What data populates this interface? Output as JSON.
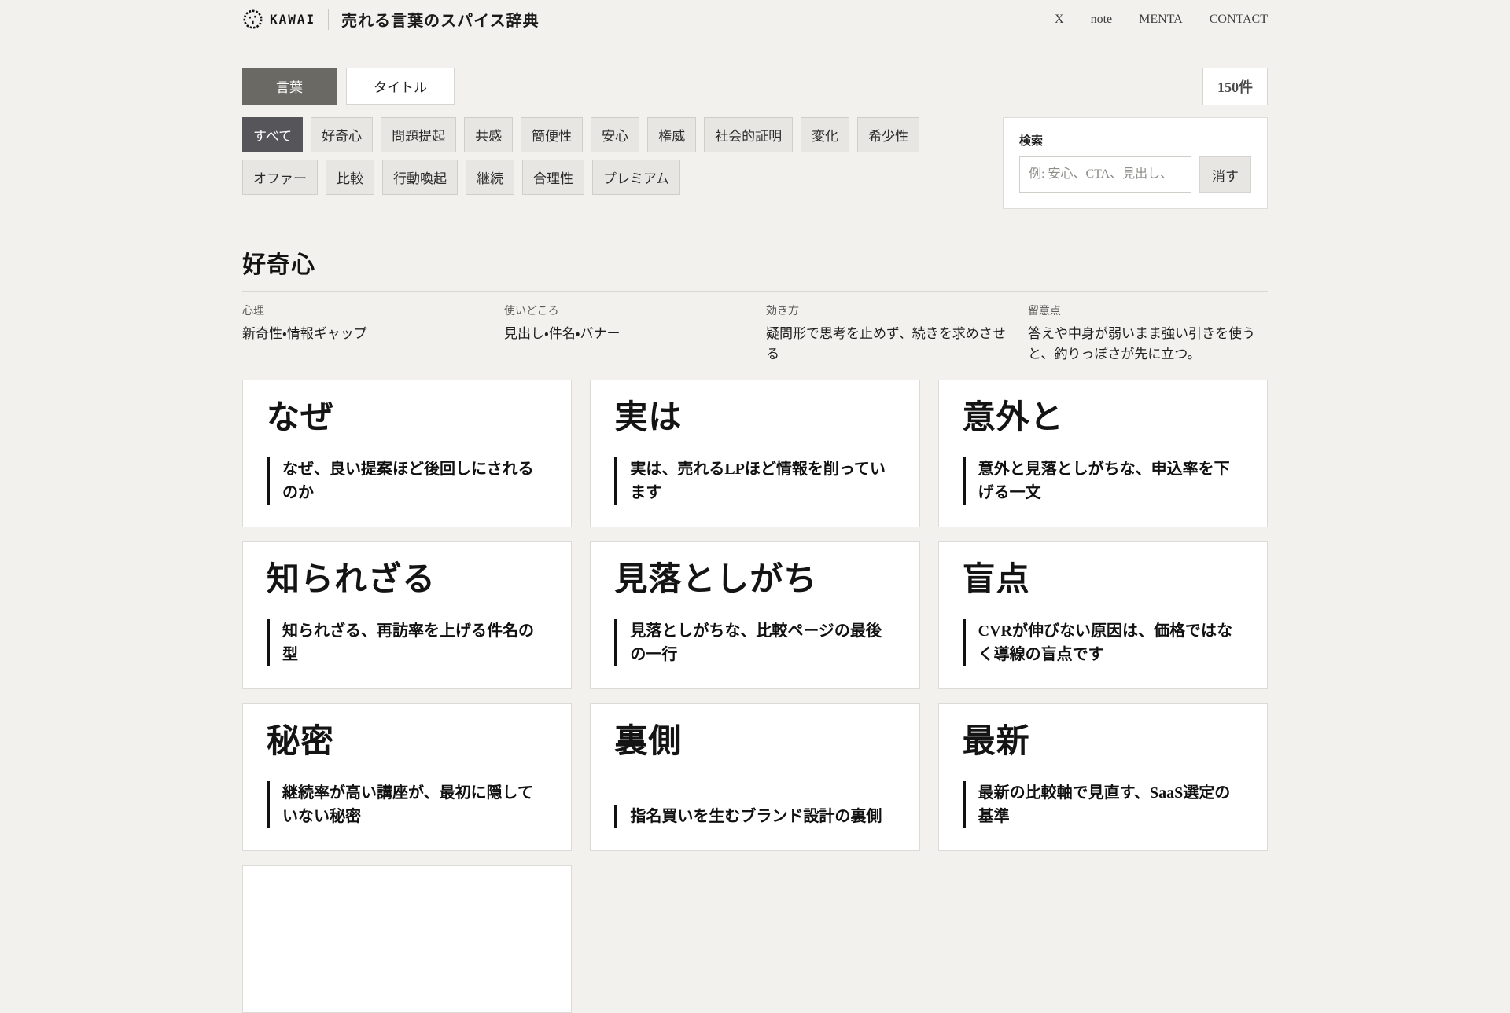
{
  "colors": {
    "page_background": "#f2f1ed",
    "active_tab": "#6a6963",
    "active_filter": "#56565a",
    "card_background": "#ffffff",
    "card_border": "#dcdbd7",
    "quote_bar": "#111111"
  },
  "header": {
    "brand": "KAWAI",
    "logo_icon": "pixel-face-icon",
    "site_title": "売れる言葉のスパイス辞典",
    "nav": [
      {
        "label": "X"
      },
      {
        "label": "note"
      },
      {
        "label": "MENTA"
      },
      {
        "label": "CONTACT"
      }
    ]
  },
  "toolbar": {
    "tabs": [
      {
        "label": "言葉",
        "active": true
      },
      {
        "label": "タイトル",
        "active": false
      }
    ],
    "count_badge": "150件",
    "filters": [
      {
        "label": "すべて",
        "active": true
      },
      {
        "label": "好奇心",
        "active": false
      },
      {
        "label": "問題提起",
        "active": false
      },
      {
        "label": "共感",
        "active": false
      },
      {
        "label": "簡便性",
        "active": false
      },
      {
        "label": "安心",
        "active": false
      },
      {
        "label": "権威",
        "active": false
      },
      {
        "label": "社会的証明",
        "active": false
      },
      {
        "label": "変化",
        "active": false
      },
      {
        "label": "希少性",
        "active": false
      },
      {
        "label": "オファー",
        "active": false
      },
      {
        "label": "比較",
        "active": false
      },
      {
        "label": "行動喚起",
        "active": false
      },
      {
        "label": "継続",
        "active": false
      },
      {
        "label": "合理性",
        "active": false
      },
      {
        "label": "プレミアム",
        "active": false
      }
    ],
    "search": {
      "label": "検索",
      "placeholder": "例: 安心、CTA、見出し、",
      "value": "",
      "clear_label": "消す"
    }
  },
  "section": {
    "title": "好奇心",
    "meta": [
      {
        "label": "心理",
        "value": "新奇性・情報ギャップ"
      },
      {
        "label": "使いどころ",
        "value": "見出し・件名・バナー"
      },
      {
        "label": "効き方",
        "value": "疑問形で思考を止めず、続きを求めさせる"
      },
      {
        "label": "留意点",
        "value": "答えや中身が弱いまま強い引きを使うと、釣りっぽさが先に立つ。"
      }
    ],
    "cards": [
      {
        "title": "なぜ",
        "quote": "なぜ、良い提案ほど後回しにされるのか"
      },
      {
        "title": "実は",
        "quote": "実は、売れるLPほど情報を削っています"
      },
      {
        "title": "意外と",
        "quote": "意外と見落としがちな、申込率を下げる一文"
      },
      {
        "title": "知られざる",
        "quote": "知られざる、再訪率を上げる件名の型"
      },
      {
        "title": "見落としがち",
        "quote": "見落としがちな、比較ページの最後の一行"
      },
      {
        "title": "盲点",
        "quote": "CVRが伸びない原因は、価格ではなく導線の盲点です"
      },
      {
        "title": "秘密",
        "quote": "継続率が高い講座が、最初に隠していない秘密"
      },
      {
        "title": "裏側",
        "quote": "指名買いを生むブランド設計の裏側"
      },
      {
        "title": "最新",
        "quote": "最新の比較軸で見直す、SaaS選定の基準"
      },
      {
        "title": "",
        "quote": ""
      }
    ]
  }
}
